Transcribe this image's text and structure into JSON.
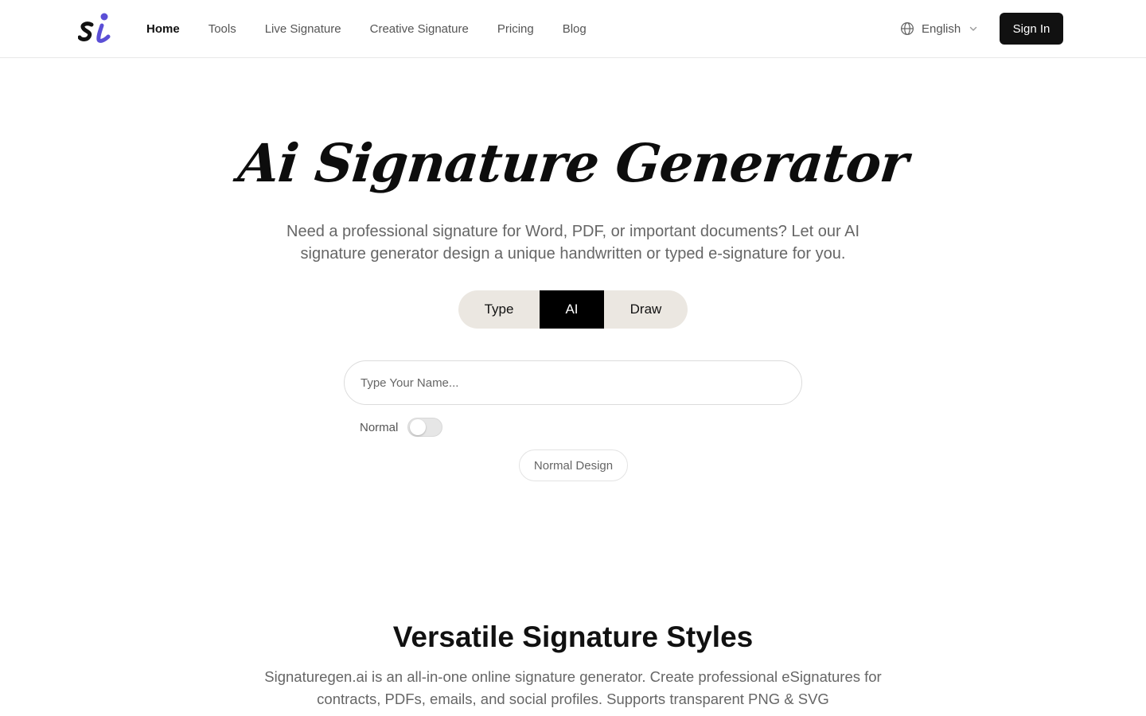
{
  "header": {
    "nav": [
      {
        "label": "Home",
        "active": true
      },
      {
        "label": "Tools",
        "active": false
      },
      {
        "label": "Live Signature",
        "active": false
      },
      {
        "label": "Creative Signature",
        "active": false
      },
      {
        "label": "Pricing",
        "active": false
      },
      {
        "label": "Blog",
        "active": false
      }
    ],
    "language": "English",
    "sign_in": "Sign In",
    "logo_text": "si",
    "brand_colors": {
      "logo_dark": "#111111",
      "logo_accent": "#5b4fd6"
    }
  },
  "hero": {
    "title": "Ai Signature Generator",
    "subtitle": "Need a professional signature for Word, PDF, or important documents? Let our AI signature generator design a unique handwritten or typed e-signature for you.",
    "tabs": [
      {
        "label": "Type",
        "selected": false
      },
      {
        "label": "AI",
        "selected": true
      },
      {
        "label": "Draw",
        "selected": false
      }
    ],
    "name_input": {
      "placeholder": "Type Your Name...",
      "value": ""
    },
    "toggle": {
      "label": "Normal",
      "on": false
    },
    "design_button": "Normal Design"
  },
  "section": {
    "title": "Versatile Signature Styles",
    "subtitle": "Signaturegen.ai is an all-in-one online signature generator. Create professional eSignatures for contracts, PDFs, emails, and social profiles. Supports transparent PNG & SVG"
  },
  "icons": {
    "language": "globe-icon",
    "language_dropdown": "chevron-down-icon"
  }
}
